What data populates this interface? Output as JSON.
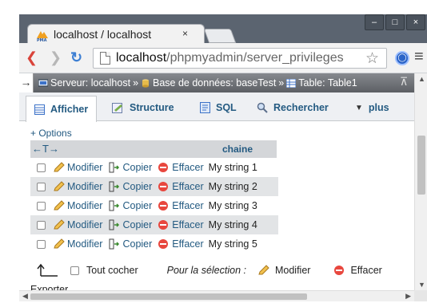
{
  "browser": {
    "tab_title": "localhost / localhost",
    "tab_close": "×",
    "window_buttons": [
      "–",
      "□",
      "×"
    ],
    "url_host": "localhost",
    "url_path": "/phpmyadmin/server_privileges"
  },
  "breadcrumb": {
    "server": "Serveur: localhost",
    "database": "Base de données: baseTest",
    "table": "Table: Table1"
  },
  "tabs": [
    {
      "label": "Afficher"
    },
    {
      "label": "Structure"
    },
    {
      "label": "SQL"
    },
    {
      "label": "Rechercher"
    },
    {
      "label": "plus"
    }
  ],
  "results": {
    "options_link": "+ Options",
    "sort_arrows": "←T→",
    "column_header": "chaine",
    "action_edit": "Modifier",
    "action_copy": "Copier",
    "action_delete": "Effacer",
    "rows": [
      {
        "value": "My string 1"
      },
      {
        "value": "My string 2"
      },
      {
        "value": "My string 3"
      },
      {
        "value": "My string 4"
      },
      {
        "value": "My string 5"
      }
    ]
  },
  "footer": {
    "check_all": "Tout cocher",
    "with_selected": "Pour la sélection :",
    "edit": "Modifier",
    "delete": "Effacer"
  },
  "exporter": "Exporter",
  "colors": {
    "link": "#235a81",
    "delete_red": "#e8473e",
    "row_alt": "#e2e4e6",
    "breadcrumb_bg": "#6f7277",
    "titlebar": "#5b6470"
  }
}
